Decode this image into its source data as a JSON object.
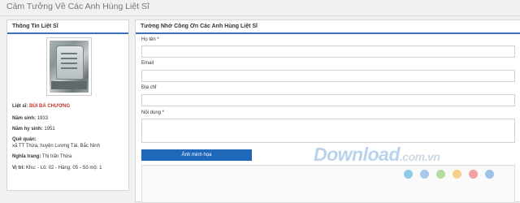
{
  "page": {
    "title": "Cảm Tưởng Về Các Anh Hùng Liệt Sĩ"
  },
  "left_panel": {
    "title": "Thông Tin Liệt Sĩ",
    "martyr_label": "Liệt sĩ:",
    "martyr_name": "BÙI BÁ CHƯƠNG",
    "birth_label": "Năm sinh:",
    "birth_value": "1933",
    "death_label": "Năm hy sinh:",
    "death_value": "1951",
    "hometown_label": "Quê quán:",
    "hometown_value": "xã TT Thừa, huyện Lương Tài, Bắc Ninh",
    "cemetery_label": "Nghĩa trang:",
    "cemetery_value": "Thị trấn Thừa",
    "location_label": "Vị trí:",
    "location_value": "Khu: - Lô: 02 - Hàng: 05 - Số mộ: 1"
  },
  "form": {
    "title": "Tưởng Nhớ Công Ơn Các Anh Hùng Liệt Sĩ",
    "name_label": "Họ tên *",
    "email_label": "Email",
    "address_label": "Địa chỉ",
    "content_label": "Nội dung *",
    "upload_button": "Ảnh minh họa"
  },
  "watermark": {
    "text_main": "Download",
    "text_domain": ".com.vn",
    "dot_colors": [
      "#8fcbe8",
      "#a9c7ea",
      "#b5dba0",
      "#f6d08a",
      "#f2a0a0",
      "#9dc2e8"
    ]
  }
}
